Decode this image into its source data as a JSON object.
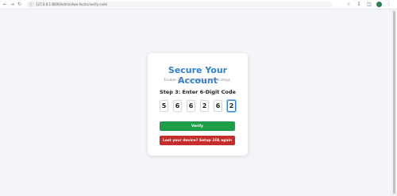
{
  "browser": {
    "url": "127.0.0.1:8000/admin/two-factor/verify-code",
    "icons": {
      "back": "arrow-left-icon",
      "forward": "arrow-right-icon",
      "reload": "reload-icon",
      "site_info": "site-info-icon",
      "bookmark": "star-icon",
      "downloads": "download-icon",
      "sidepanel": "side-panel-icon",
      "menu": "kebab-menu-icon"
    }
  },
  "card": {
    "title": "Secure Your Account",
    "subtitle": "Enable 2FA in just a few simple steps.",
    "step_label": "Step 3: Enter 6-Digit Code",
    "code_digits": [
      "5",
      "6",
      "6",
      "2",
      "6",
      "2"
    ],
    "verify_label": "Verify",
    "reset_label": "Lost your device? Setup 2FA again"
  },
  "colors": {
    "title": "#2f80d1",
    "verify": "#1f9e4a",
    "reset": "#c72c2c",
    "background": "#f3f5f9"
  }
}
